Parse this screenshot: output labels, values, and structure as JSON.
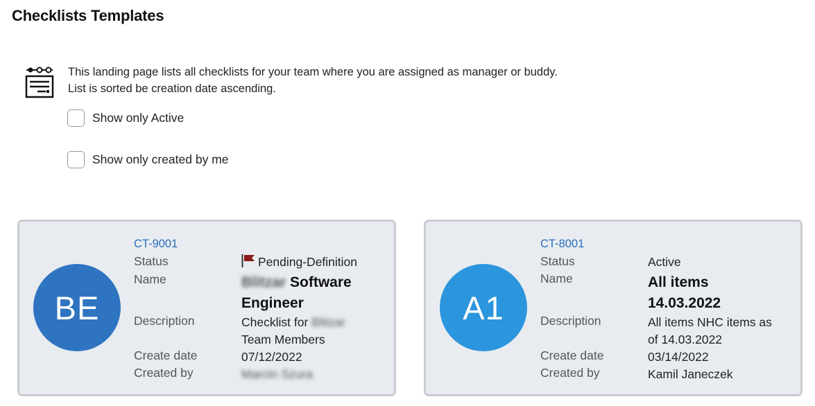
{
  "page": {
    "title": "Checklists Templates"
  },
  "info": {
    "line1": "This landing page lists all checklists for your team where you are assigned as manager or buddy.",
    "line2": "List is sorted be creation date ascending.",
    "icon": "checklist-settings-icon"
  },
  "filters": [
    {
      "label": "Show only Active",
      "checked": false
    },
    {
      "label": "Show only created by me",
      "checked": false
    }
  ],
  "labels": {
    "status": "Status",
    "name": "Name",
    "description": "Description",
    "create_date": "Create date",
    "created_by": "Created by"
  },
  "cards": [
    {
      "avatar_text": "BE",
      "avatar_color": "#2f74c0",
      "id": "CT-9001",
      "status": "Pending-Definition",
      "status_flag_color": "#8b1a1a",
      "name_blurred": "Blitzar",
      "name_visible": "Software Engineer",
      "description_prefix": "Checklist for",
      "description_blurred": "Blitzar",
      "description_suffix": "Team Members",
      "create_date": "07/12/2022",
      "created_by_blurred": "Marcin Szura"
    },
    {
      "avatar_text": "A1",
      "avatar_color": "#2b95dd",
      "id": "CT-8001",
      "status": "Active",
      "name": "All items 14.03.2022",
      "description": "All items NHC items as of 14.03.2022",
      "create_date": "03/14/2022",
      "created_by": "Kamil Janeczek"
    }
  ]
}
